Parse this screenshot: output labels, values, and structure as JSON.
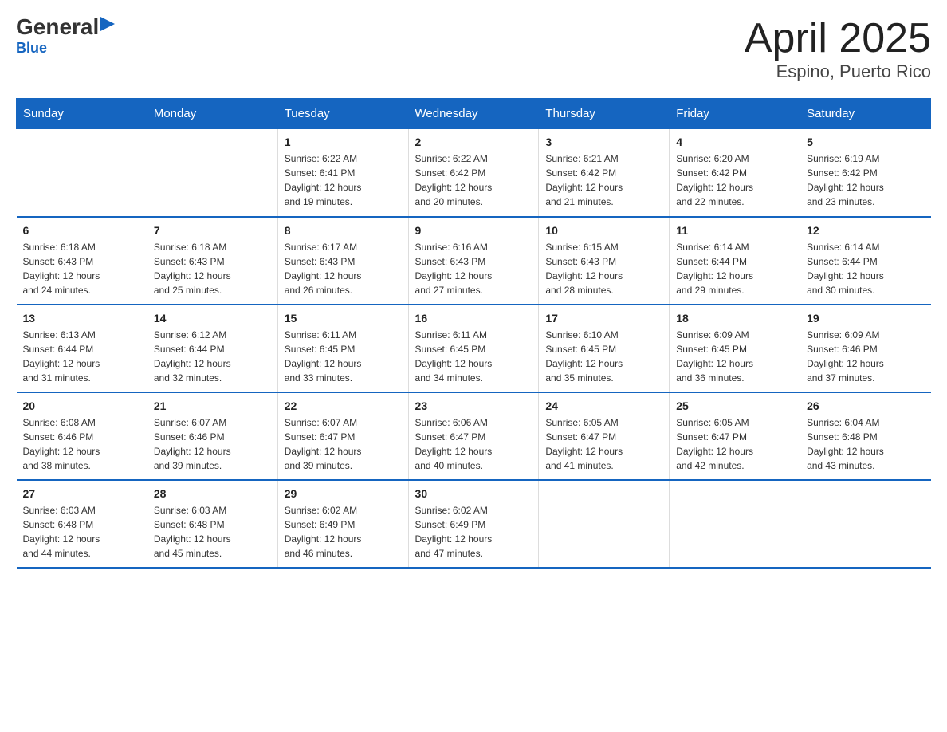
{
  "logo": {
    "general": "General",
    "triangle": "▶",
    "blue": "Blue"
  },
  "title": "April 2025",
  "subtitle": "Espino, Puerto Rico",
  "days_of_week": [
    "Sunday",
    "Monday",
    "Tuesday",
    "Wednesday",
    "Thursday",
    "Friday",
    "Saturday"
  ],
  "weeks": [
    [
      {
        "day": "",
        "info": ""
      },
      {
        "day": "",
        "info": ""
      },
      {
        "day": "1",
        "info": "Sunrise: 6:22 AM\nSunset: 6:41 PM\nDaylight: 12 hours\nand 19 minutes."
      },
      {
        "day": "2",
        "info": "Sunrise: 6:22 AM\nSunset: 6:42 PM\nDaylight: 12 hours\nand 20 minutes."
      },
      {
        "day": "3",
        "info": "Sunrise: 6:21 AM\nSunset: 6:42 PM\nDaylight: 12 hours\nand 21 minutes."
      },
      {
        "day": "4",
        "info": "Sunrise: 6:20 AM\nSunset: 6:42 PM\nDaylight: 12 hours\nand 22 minutes."
      },
      {
        "day": "5",
        "info": "Sunrise: 6:19 AM\nSunset: 6:42 PM\nDaylight: 12 hours\nand 23 minutes."
      }
    ],
    [
      {
        "day": "6",
        "info": "Sunrise: 6:18 AM\nSunset: 6:43 PM\nDaylight: 12 hours\nand 24 minutes."
      },
      {
        "day": "7",
        "info": "Sunrise: 6:18 AM\nSunset: 6:43 PM\nDaylight: 12 hours\nand 25 minutes."
      },
      {
        "day": "8",
        "info": "Sunrise: 6:17 AM\nSunset: 6:43 PM\nDaylight: 12 hours\nand 26 minutes."
      },
      {
        "day": "9",
        "info": "Sunrise: 6:16 AM\nSunset: 6:43 PM\nDaylight: 12 hours\nand 27 minutes."
      },
      {
        "day": "10",
        "info": "Sunrise: 6:15 AM\nSunset: 6:43 PM\nDaylight: 12 hours\nand 28 minutes."
      },
      {
        "day": "11",
        "info": "Sunrise: 6:14 AM\nSunset: 6:44 PM\nDaylight: 12 hours\nand 29 minutes."
      },
      {
        "day": "12",
        "info": "Sunrise: 6:14 AM\nSunset: 6:44 PM\nDaylight: 12 hours\nand 30 minutes."
      }
    ],
    [
      {
        "day": "13",
        "info": "Sunrise: 6:13 AM\nSunset: 6:44 PM\nDaylight: 12 hours\nand 31 minutes."
      },
      {
        "day": "14",
        "info": "Sunrise: 6:12 AM\nSunset: 6:44 PM\nDaylight: 12 hours\nand 32 minutes."
      },
      {
        "day": "15",
        "info": "Sunrise: 6:11 AM\nSunset: 6:45 PM\nDaylight: 12 hours\nand 33 minutes."
      },
      {
        "day": "16",
        "info": "Sunrise: 6:11 AM\nSunset: 6:45 PM\nDaylight: 12 hours\nand 34 minutes."
      },
      {
        "day": "17",
        "info": "Sunrise: 6:10 AM\nSunset: 6:45 PM\nDaylight: 12 hours\nand 35 minutes."
      },
      {
        "day": "18",
        "info": "Sunrise: 6:09 AM\nSunset: 6:45 PM\nDaylight: 12 hours\nand 36 minutes."
      },
      {
        "day": "19",
        "info": "Sunrise: 6:09 AM\nSunset: 6:46 PM\nDaylight: 12 hours\nand 37 minutes."
      }
    ],
    [
      {
        "day": "20",
        "info": "Sunrise: 6:08 AM\nSunset: 6:46 PM\nDaylight: 12 hours\nand 38 minutes."
      },
      {
        "day": "21",
        "info": "Sunrise: 6:07 AM\nSunset: 6:46 PM\nDaylight: 12 hours\nand 39 minutes."
      },
      {
        "day": "22",
        "info": "Sunrise: 6:07 AM\nSunset: 6:47 PM\nDaylight: 12 hours\nand 39 minutes."
      },
      {
        "day": "23",
        "info": "Sunrise: 6:06 AM\nSunset: 6:47 PM\nDaylight: 12 hours\nand 40 minutes."
      },
      {
        "day": "24",
        "info": "Sunrise: 6:05 AM\nSunset: 6:47 PM\nDaylight: 12 hours\nand 41 minutes."
      },
      {
        "day": "25",
        "info": "Sunrise: 6:05 AM\nSunset: 6:47 PM\nDaylight: 12 hours\nand 42 minutes."
      },
      {
        "day": "26",
        "info": "Sunrise: 6:04 AM\nSunset: 6:48 PM\nDaylight: 12 hours\nand 43 minutes."
      }
    ],
    [
      {
        "day": "27",
        "info": "Sunrise: 6:03 AM\nSunset: 6:48 PM\nDaylight: 12 hours\nand 44 minutes."
      },
      {
        "day": "28",
        "info": "Sunrise: 6:03 AM\nSunset: 6:48 PM\nDaylight: 12 hours\nand 45 minutes."
      },
      {
        "day": "29",
        "info": "Sunrise: 6:02 AM\nSunset: 6:49 PM\nDaylight: 12 hours\nand 46 minutes."
      },
      {
        "day": "30",
        "info": "Sunrise: 6:02 AM\nSunset: 6:49 PM\nDaylight: 12 hours\nand 47 minutes."
      },
      {
        "day": "",
        "info": ""
      },
      {
        "day": "",
        "info": ""
      },
      {
        "day": "",
        "info": ""
      }
    ]
  ]
}
